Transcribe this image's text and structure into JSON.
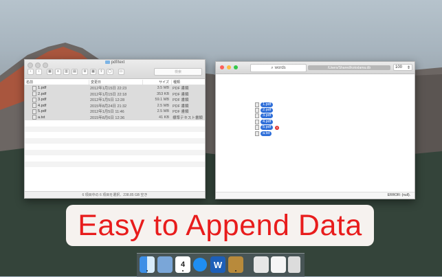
{
  "finder": {
    "title": "pdf/text",
    "search_placeholder": "検索",
    "columns": {
      "name": "名前",
      "date": "変更日",
      "size": "サイズ",
      "kind": "種類"
    },
    "rows": [
      {
        "name": "1.pdf",
        "date": "2012年1月15日 22:23",
        "size": "3.5 MB",
        "kind": "PDF 書類",
        "selected": true
      },
      {
        "name": "2.pdf",
        "date": "2012年1月15日 22:18",
        "size": "353 KB",
        "kind": "PDF 書類",
        "selected": true
      },
      {
        "name": "3.pdf",
        "date": "2012年1月5日 12:28",
        "size": "59.1 MB",
        "kind": "PDF 書類",
        "selected": true
      },
      {
        "name": "4.pdf",
        "date": "2015年8月24日 21:32",
        "size": "2.5 MB",
        "kind": "PDF 書類",
        "selected": true
      },
      {
        "name": "5.pdf",
        "date": "2012年1月5日 11:46",
        "size": "2.5 MB",
        "kind": "PDF 書類",
        "selected": true
      },
      {
        "name": "a.txt",
        "date": "2015年8月6日 12:36",
        "size": "41 KB",
        "kind": "標準テキスト書類",
        "selected": false
      }
    ],
    "status": "6 項目中の 6 項目を選択、238.85 GB 空き"
  },
  "app": {
    "search_text": "words",
    "path": "/Users/Shared/kotodama.db",
    "zoom": "100",
    "tags": [
      "1.pdf",
      "2.pdf",
      "3.pdf",
      "4.pdf",
      "5.pdf",
      "a.txt"
    ],
    "badge_count": "6",
    "status": "ERROR: (null)."
  },
  "banner": {
    "text": "Easy to Append Data"
  },
  "colors": {
    "selection": "#2f6fd9",
    "banner_text": "#e81c1c",
    "close": "#fc605b",
    "minimize": "#fdbc40",
    "zoom": "#34c84a"
  },
  "dock": [
    {
      "name": "finder-icon"
    },
    {
      "name": "preview-icon"
    },
    {
      "name": "calendar-icon",
      "label": "4"
    },
    {
      "name": "safari-icon"
    },
    {
      "name": "word-icon",
      "label": "W"
    },
    {
      "name": "notes-icon"
    },
    {
      "name": "window-icon"
    },
    {
      "name": "document-icon"
    },
    {
      "name": "trash-icon"
    }
  ]
}
